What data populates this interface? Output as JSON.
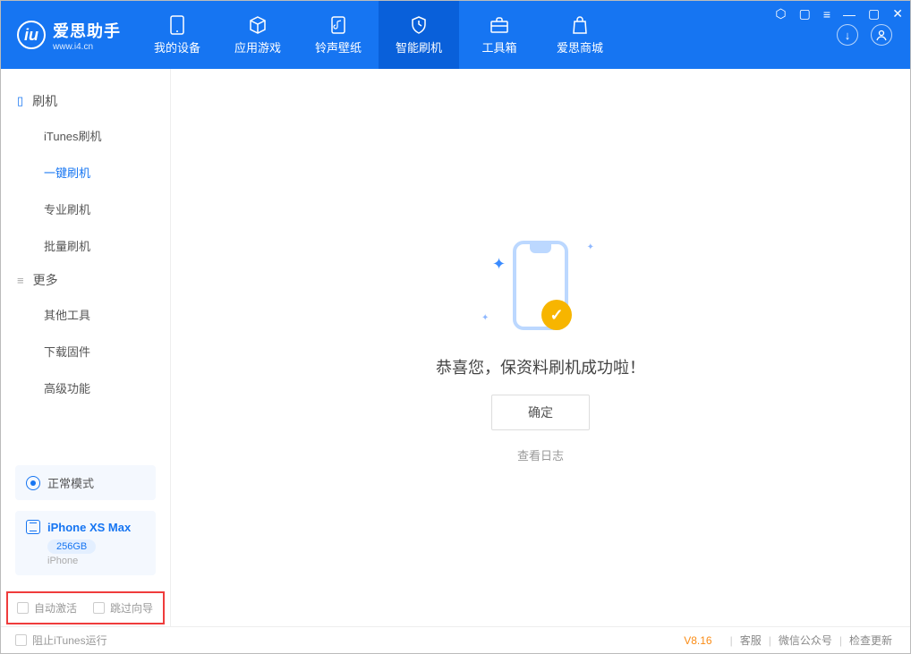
{
  "header": {
    "app_title": "爱思助手",
    "app_url": "www.i4.cn",
    "nav": [
      {
        "label": "我的设备"
      },
      {
        "label": "应用游戏"
      },
      {
        "label": "铃声壁纸"
      },
      {
        "label": "智能刷机"
      },
      {
        "label": "工具箱"
      },
      {
        "label": "爱思商城"
      }
    ]
  },
  "sidebar": {
    "section_flash": "刷机",
    "items_flash": [
      {
        "label": "iTunes刷机"
      },
      {
        "label": "一键刷机"
      },
      {
        "label": "专业刷机"
      },
      {
        "label": "批量刷机"
      }
    ],
    "section_more": "更多",
    "items_more": [
      {
        "label": "其他工具"
      },
      {
        "label": "下载固件"
      },
      {
        "label": "高级功能"
      }
    ],
    "mode": "正常模式",
    "device_name": "iPhone XS Max",
    "device_capacity": "256GB",
    "device_type": "iPhone",
    "checks": {
      "auto_activate": "自动激活",
      "skip_guide": "跳过向导"
    }
  },
  "main": {
    "success_msg": "恭喜您，保资料刷机成功啦！",
    "ok_button": "确定",
    "view_log": "查看日志"
  },
  "footer": {
    "block_itunes": "阻止iTunes运行",
    "version": "V8.16",
    "links": [
      "客服",
      "微信公众号",
      "检查更新"
    ]
  }
}
